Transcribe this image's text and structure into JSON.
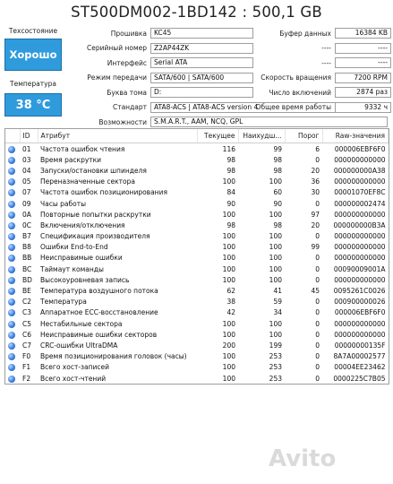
{
  "title": "ST500DM002-1BD142 : 500,1 GB",
  "status": {
    "health_label": "Техсостояние",
    "health_value": "Хорошо",
    "temp_label": "Температура",
    "temp_value": "38 °C"
  },
  "info": {
    "firmware_label": "Прошивка",
    "firmware": "KC45",
    "serial_label": "Серийный номер",
    "serial": "Z2AP44ZK",
    "interface_label": "Интерфейс",
    "interface": "Serial ATA",
    "transfer_label": "Режим передачи",
    "transfer": "SATA/600 | SATA/600",
    "volume_label": "Буква тома",
    "volume": "D:",
    "standard_label": "Стандарт",
    "standard": "ATA8-ACS | ATA8-ACS version 4",
    "features_label": "Возможности",
    "features": "S.M.A.R.T., AAM, NCQ, GPL",
    "buffer_label": "Буфер данных",
    "buffer": "16384 KB",
    "r1": "----",
    "r1v": "----",
    "r2": "----",
    "r2v": "----",
    "rpm_label": "Скорость вращения",
    "rpm": "7200 RPM",
    "poweron_label": "Число включений",
    "poweron": "2874 раз",
    "hours_label": "Общее время работы",
    "hours": "9332 ч"
  },
  "table": {
    "headers": [
      "",
      "ID",
      "Атрибут",
      "Текущее",
      "Наихудш...",
      "Порог",
      "Raw-значения"
    ],
    "rows": [
      [
        "01",
        "Частота ошибок чтения",
        "116",
        "99",
        "6",
        "000006EBF6F0"
      ],
      [
        "03",
        "Время раскрутки",
        "98",
        "98",
        "0",
        "000000000000"
      ],
      [
        "04",
        "Запуски/остановки шпинделя",
        "98",
        "98",
        "20",
        "000000000A38"
      ],
      [
        "05",
        "Переназначенные сектора",
        "100",
        "100",
        "36",
        "000000000000"
      ],
      [
        "07",
        "Частота ошибок позиционирования",
        "84",
        "60",
        "30",
        "00001070EF8C"
      ],
      [
        "09",
        "Часы работы",
        "90",
        "90",
        "0",
        "000000002474"
      ],
      [
        "0A",
        "Повторные попытки раскрутки",
        "100",
        "100",
        "97",
        "000000000000"
      ],
      [
        "0C",
        "Включения/отключения",
        "98",
        "98",
        "20",
        "000000000B3A"
      ],
      [
        "B7",
        "Спецификация производителя",
        "100",
        "100",
        "0",
        "000000000000"
      ],
      [
        "B8",
        "Ошибки End-to-End",
        "100",
        "100",
        "99",
        "000000000000"
      ],
      [
        "BB",
        "Неисправимые ошибки",
        "100",
        "100",
        "0",
        "000000000000"
      ],
      [
        "BC",
        "Таймаут команды",
        "100",
        "100",
        "0",
        "00090009001A"
      ],
      [
        "BD",
        "Высокоуровневая запись",
        "100",
        "100",
        "0",
        "000000000000"
      ],
      [
        "BE",
        "Температура воздушного потока",
        "62",
        "41",
        "45",
        "0095261C0026"
      ],
      [
        "C2",
        "Температура",
        "38",
        "59",
        "0",
        "000900000026"
      ],
      [
        "C3",
        "Аппаратное ECC-восстановление",
        "42",
        "34",
        "0",
        "000006EBF6F0"
      ],
      [
        "C5",
        "Нестабильные сектора",
        "100",
        "100",
        "0",
        "000000000000"
      ],
      [
        "C6",
        "Неисправимые ошибки секторов",
        "100",
        "100",
        "0",
        "000000000000"
      ],
      [
        "C7",
        "CRC-ошибки UltraDMA",
        "200",
        "199",
        "0",
        "00000000135F"
      ],
      [
        "F0",
        "Время позиционирования головок (часы)",
        "100",
        "253",
        "0",
        "8A7A00002577"
      ],
      [
        "F1",
        "Всего хост-записей",
        "100",
        "253",
        "0",
        "00004EE23462"
      ],
      [
        "F2",
        "Всего хост-чтений",
        "100",
        "253",
        "0",
        "0000225C7B05"
      ]
    ]
  },
  "watermark": "Avito"
}
